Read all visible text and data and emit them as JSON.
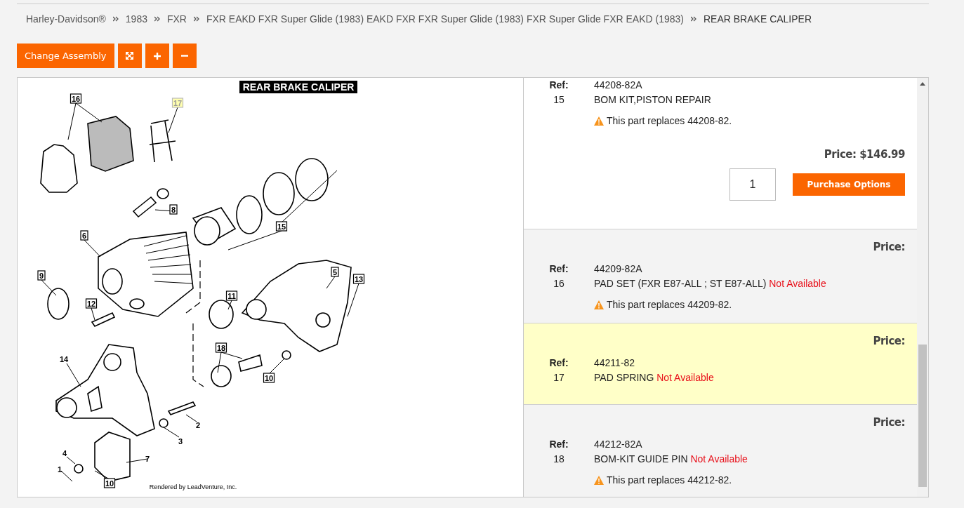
{
  "breadcrumb": [
    {
      "label": "Harley-Davidson®",
      "current": false
    },
    {
      "label": "1983",
      "current": false
    },
    {
      "label": "FXR",
      "current": false
    },
    {
      "label": "FXR EAKD FXR Super Glide (1983) EAKD FXR FXR Super Glide (1983) FXR Super Glide FXR EAKD (1983)",
      "current": false
    },
    {
      "label": "REAR BRAKE CALIPER",
      "current": true
    }
  ],
  "toolbar": {
    "change_assembly": "Change Assembly",
    "tools": [
      {
        "kind": "fullscreen"
      },
      {
        "kind": "zoom-in"
      },
      {
        "kind": "zoom-out"
      }
    ]
  },
  "diagram": {
    "title": "REAR BRAKE CALIPER",
    "footer": "Rendered by LeadVenture, Inc.",
    "callouts": [
      {
        "label": "16",
        "boxed": true,
        "highlighted": false
      },
      {
        "label": "17",
        "boxed": true,
        "highlighted": true
      },
      {
        "label": "8",
        "boxed": true,
        "highlighted": false
      },
      {
        "label": "15",
        "boxed": true,
        "highlighted": false
      },
      {
        "label": "6",
        "boxed": true,
        "highlighted": false
      },
      {
        "label": "9",
        "boxed": true,
        "highlighted": false
      },
      {
        "label": "12",
        "boxed": true,
        "highlighted": false
      },
      {
        "label": "11",
        "boxed": true,
        "highlighted": false
      },
      {
        "label": "5",
        "boxed": true,
        "highlighted": false
      },
      {
        "label": "13",
        "boxed": true,
        "highlighted": false
      },
      {
        "label": "14",
        "boxed": false,
        "highlighted": false
      },
      {
        "label": "18",
        "boxed": true,
        "highlighted": false
      },
      {
        "label": "10",
        "boxed": true,
        "highlighted": false
      },
      {
        "label": "2",
        "boxed": false,
        "highlighted": false
      },
      {
        "label": "3",
        "boxed": false,
        "highlighted": false
      },
      {
        "label": "4",
        "boxed": false,
        "highlighted": false
      },
      {
        "label": "7",
        "boxed": false,
        "highlighted": false
      },
      {
        "label": "1",
        "boxed": false,
        "highlighted": false
      },
      {
        "label": "10",
        "boxed": true,
        "highlighted": false
      }
    ]
  },
  "parts": [
    {
      "kind": "purchasable",
      "selected": false,
      "ref_label": "Ref:",
      "ref": "15",
      "part_number": "44208-82A",
      "description": "BOM KIT,PISTON REPAIR",
      "note": "This part replaces 44208-82.",
      "price": "Price: $146.99",
      "quantity": "1",
      "purchase_label": "Purchase Options"
    },
    {
      "kind": "unavailable",
      "selected": false,
      "ref_label": "Ref:",
      "ref": "16",
      "part_number": "44209-82A",
      "description": "PAD SET (FXR E87-ALL ; ST E87-ALL)",
      "availability": "Not Available",
      "note": "This part replaces 44209-82.",
      "price": "Price:"
    },
    {
      "kind": "unavailable",
      "selected": true,
      "ref_label": "Ref:",
      "ref": "17",
      "part_number": "44211-82",
      "description": "PAD SPRING",
      "availability": "Not Available",
      "price": "Price:"
    },
    {
      "kind": "unavailable",
      "selected": false,
      "ref_label": "Ref:",
      "ref": "18",
      "part_number": "44212-82A",
      "description": "BOM-KIT GUIDE PIN",
      "availability": "Not Available",
      "note": "This part replaces 44212-82.",
      "price": "Price:"
    }
  ]
}
